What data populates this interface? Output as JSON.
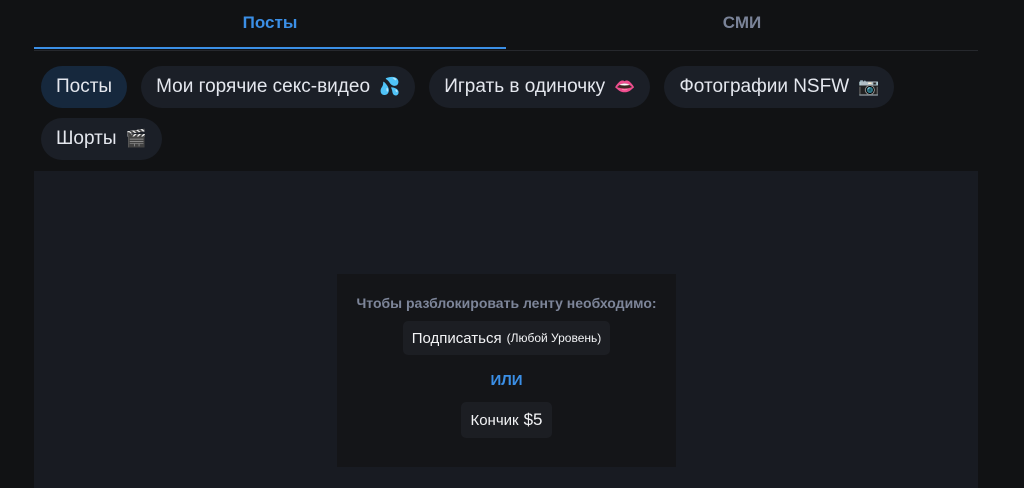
{
  "tabs": [
    {
      "label": "Посты",
      "active": true
    },
    {
      "label": "СМИ",
      "active": false
    }
  ],
  "chips": [
    {
      "label": "Посты",
      "icon": "",
      "active": true
    },
    {
      "label": "Мои горячие секс-видео",
      "icon": "💦",
      "active": false
    },
    {
      "label": "Играть в одиночку",
      "icon": "👄",
      "active": false
    },
    {
      "label": "Фотографии NSFW",
      "icon": "📷",
      "active": false
    },
    {
      "label": "Шорты",
      "icon": "🎬",
      "active": false
    }
  ],
  "lock": {
    "title": "Чтобы разблокировать ленту необходимо:",
    "subscribe_label": "Подписаться",
    "subscribe_note": "(Любой Уровень)",
    "or_label": "ИЛИ",
    "tip_label": "Кончик",
    "tip_amount": "$5"
  },
  "colors": {
    "background": "#111214",
    "accent": "#3b8fe6",
    "chip_bg": "#1b1f27",
    "chip_active_bg": "#16283d",
    "feed_bg": "#181b22",
    "lockbox_bg": "#141518"
  }
}
